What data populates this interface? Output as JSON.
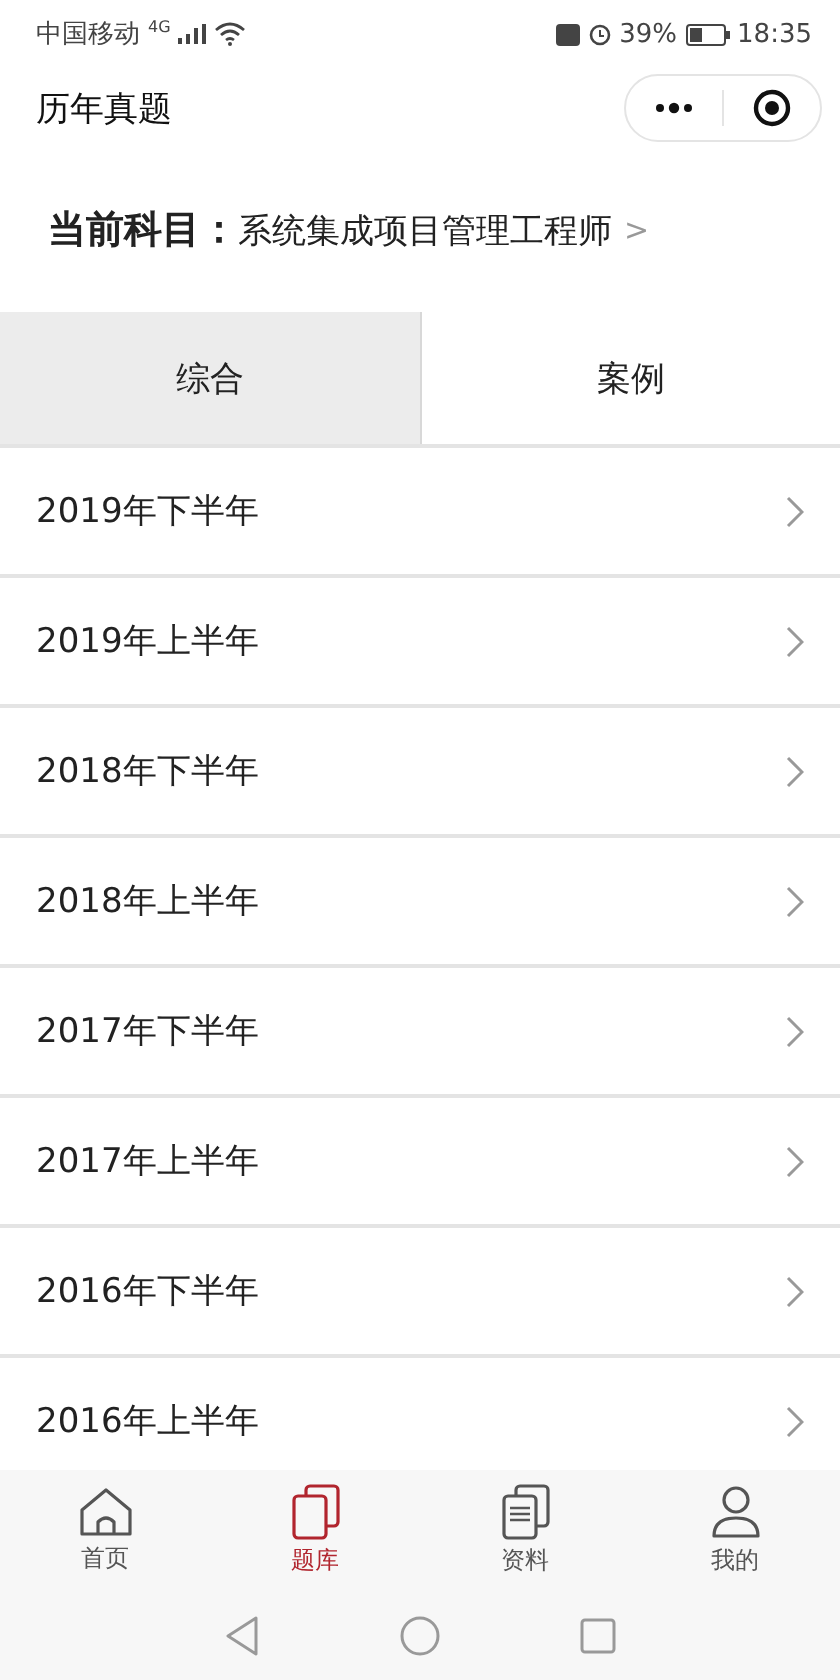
{
  "status_bar": {
    "carrier": "中国移动",
    "network": "4G",
    "battery": "39%",
    "time": "18:35"
  },
  "header": {
    "title": "历年真题"
  },
  "subject": {
    "label": "当前科目：",
    "value": "系统集成项目管理工程师",
    "arrow": ">"
  },
  "tabs": [
    {
      "label": "综合",
      "selected": true
    },
    {
      "label": "案例",
      "selected": false
    }
  ],
  "papers": [
    "2019年下半年",
    "2019年上半年",
    "2018年下半年",
    "2018年上半年",
    "2017年下半年",
    "2017年上半年",
    "2016年下半年",
    "2016年上半年"
  ],
  "bottom_nav": [
    {
      "label": "首页",
      "kind": "home",
      "selected": false
    },
    {
      "label": "题库",
      "kind": "bank",
      "selected": true
    },
    {
      "label": "资料",
      "kind": "docs",
      "selected": false
    },
    {
      "label": "我的",
      "kind": "user",
      "selected": false
    }
  ]
}
